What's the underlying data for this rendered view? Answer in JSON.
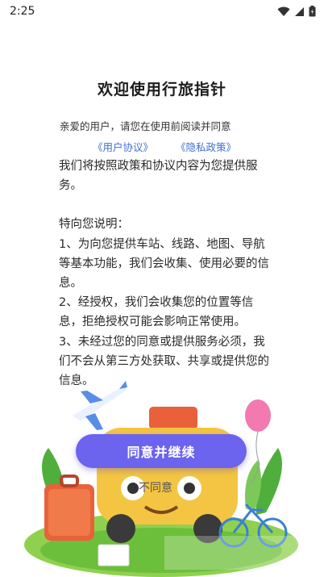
{
  "status_bar": {
    "time": "2:25",
    "icons": [
      "wifi-icon",
      "signal-icon",
      "battery-icon"
    ]
  },
  "dialog": {
    "title": "欢迎使用行旅指针",
    "intro": "亲爱的用户，请您在使用前阅读并同意",
    "links": {
      "user_agreement": "《用户协议》",
      "privacy_policy": "《隐私政策》"
    },
    "paragraph1": "我们将按照政策和协议内容为您提供服务。",
    "heading": "特向您说明：",
    "item1": "1、为向您提供车站、线路、地图、导航等基本功能，我们会收集、使用必要的信息。",
    "item2": "2、经授权，我们会收集您的位置等信息，拒绝授权可能会影响正常使用。",
    "item3": "3、未经过您的同意或提供服务必须，我们不会从第三方处获取、共享或提供您的信息。",
    "agree_button": "同意并继续",
    "disagree_link": "不同意"
  },
  "colors": {
    "button": "#6c63ee",
    "link": "#3e6fd6",
    "bus": "#f4c542"
  }
}
